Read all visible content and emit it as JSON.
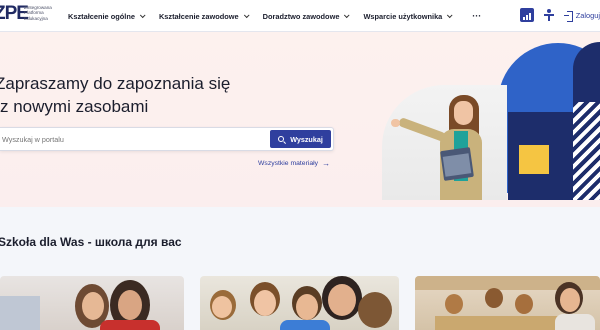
{
  "header": {
    "logo_mark": "ZPE",
    "logo_text": "Zintegrowana Platforma Edukacyjna",
    "nav": [
      {
        "label": "Kształcenie ogólne"
      },
      {
        "label": "Kształcenie zawodowe"
      },
      {
        "label": "Doradztwo zawodowe"
      },
      {
        "label": "Wsparcie użytkownika"
      }
    ],
    "more": "···",
    "login_label": "Zaloguj"
  },
  "hero": {
    "title_line1": "Zapraszamy do zapoznania się",
    "title_line2": "z nowymi zasobami",
    "search_placeholder": "Wyszukaj w portalu",
    "search_button": "Wyszukaj",
    "all_materials": "Wszystkie materiały",
    "colors": {
      "navy": "#1d2d6b",
      "blue": "#2f63c8",
      "yellow": "#f5c542",
      "button": "#2f3f9e"
    }
  },
  "section": {
    "title": "Szkoła dla Was - школа для вас"
  },
  "icons": [
    "accessibility-icon",
    "person-icon",
    "login-icon",
    "search-icon",
    "arrow-right-icon",
    "chevron-down-icon"
  ]
}
